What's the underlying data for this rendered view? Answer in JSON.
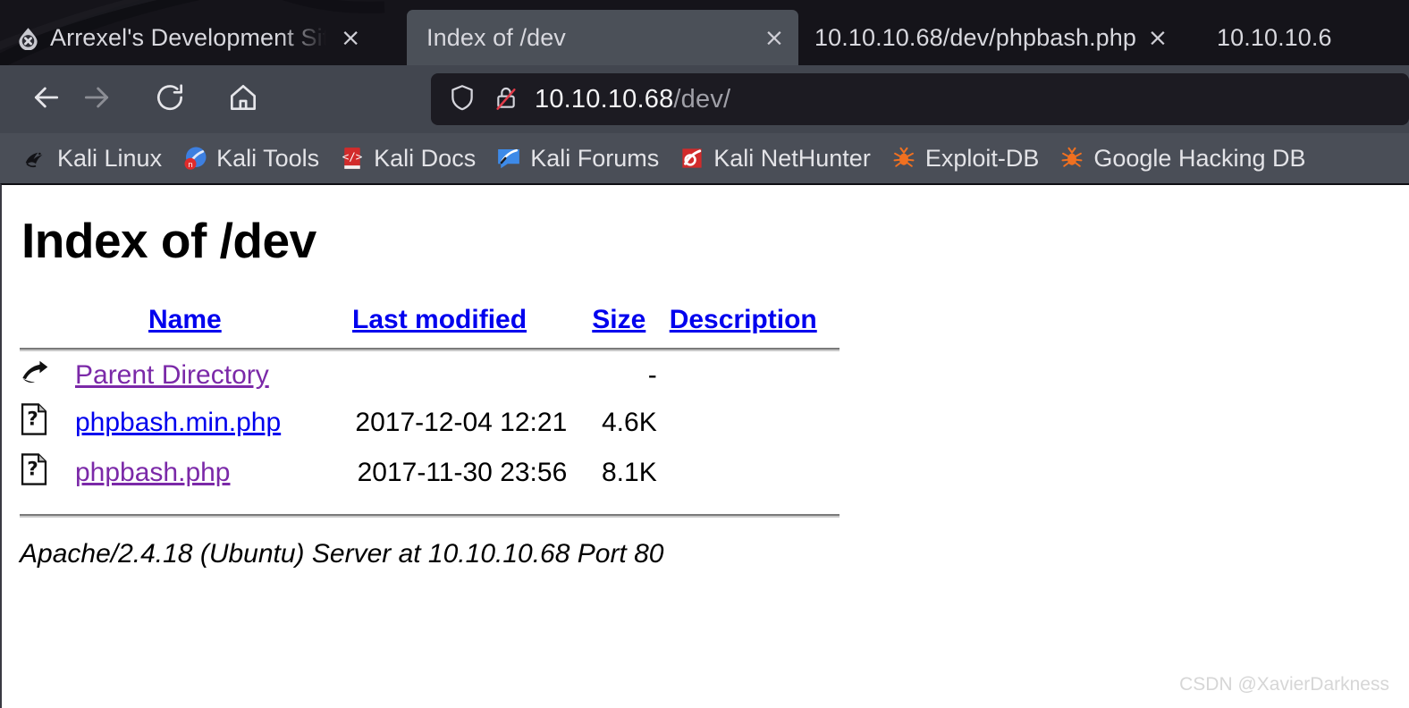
{
  "browser": {
    "tabs": [
      {
        "title": "Arrexel's Development Sit",
        "favicon": "broken-droplet-icon",
        "active": false,
        "close_label": "×"
      },
      {
        "title": "Index of /dev",
        "favicon": "none",
        "active": true,
        "close_label": "×"
      },
      {
        "title": "10.10.10.68/dev/phpbash.php",
        "favicon": "none",
        "active": false,
        "close_label": "×"
      },
      {
        "title": "10.10.10.6",
        "favicon": "none",
        "active": false,
        "close_label": "×"
      }
    ],
    "nav": {
      "back_label": "back-arrow",
      "forward_label": "forward-arrow",
      "reload_label": "reload",
      "home_label": "home"
    },
    "urlbar": {
      "shield_label": "tracking-protection-shield",
      "lock_label": "insecure-connection-broken-padlock",
      "host": "10.10.10.68",
      "path": "/dev/"
    },
    "bookmarks": [
      {
        "label": "Kali Linux",
        "icon": "kali-dragon-icon"
      },
      {
        "label": "Kali Tools",
        "icon": "kali-tools-icon"
      },
      {
        "label": "Kali Docs",
        "icon": "kali-docs-icon"
      },
      {
        "label": "Kali Forums",
        "icon": "kali-forums-icon"
      },
      {
        "label": "Kali NetHunter",
        "icon": "kali-nethunter-icon"
      },
      {
        "label": "Exploit-DB",
        "icon": "exploit-db-icon"
      },
      {
        "label": "Google Hacking DB",
        "icon": "google-hacking-db-icon"
      }
    ]
  },
  "page": {
    "heading": "Index of /dev",
    "columns": {
      "name": "Name",
      "last_modified": "Last modified",
      "size": "Size",
      "description": "Description"
    },
    "rows": [
      {
        "icon": "parent-directory-icon",
        "name": "Parent Directory",
        "last_modified": "",
        "size": "-",
        "description": "",
        "visited": true
      },
      {
        "icon": "unknown-file-icon",
        "name": "phpbash.min.php",
        "last_modified": "2017-12-04 12:21",
        "size": "4.6K",
        "description": "",
        "visited": false
      },
      {
        "icon": "unknown-file-icon",
        "name": "phpbash.php",
        "last_modified": "2017-11-30 23:56",
        "size": "8.1K",
        "description": "",
        "visited": true
      }
    ],
    "footer": "Apache/2.4.18 (Ubuntu) Server at 10.10.10.68 Port 80"
  },
  "watermark": "CSDN @XavierDarkness",
  "colors": {
    "link": "#0000ee",
    "visited_link": "#7b29a8",
    "tab_active_bg": "#4b5058",
    "toolbar_bg": "#42464f",
    "bookmarks_bg": "#4a4e57",
    "urlbar_bg": "#1c1b22"
  }
}
